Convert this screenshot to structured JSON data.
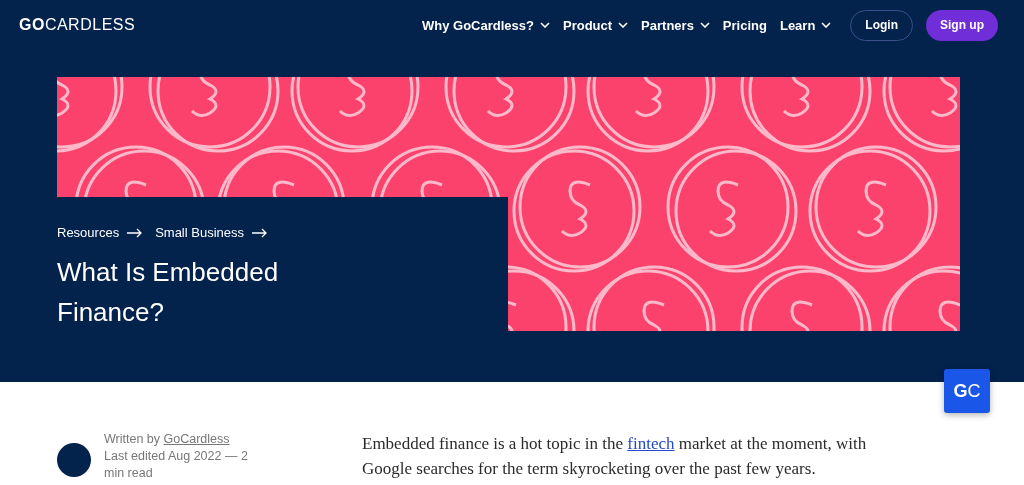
{
  "header": {
    "logo_bold": "GO",
    "logo_rest": "CARDLESS",
    "nav": [
      {
        "label": "Why GoCardless?",
        "dropdown": true
      },
      {
        "label": "Product",
        "dropdown": true
      },
      {
        "label": "Partners",
        "dropdown": true
      },
      {
        "label": "Pricing",
        "dropdown": false
      },
      {
        "label": "Learn",
        "dropdown": true
      }
    ],
    "login": "Login",
    "signup": "Sign up"
  },
  "hero": {
    "breadcrumbs": [
      "Resources",
      "Small Business"
    ],
    "title": "What Is Embedded Finance?"
  },
  "chat_badge": {
    "bold": "G",
    "rest": "C"
  },
  "article": {
    "author_prefix": "Written by",
    "author": "GoCardless",
    "edited": "Last edited Aug 2022 — 2",
    "read": "min read",
    "intro_before": "Embedded finance is a hot topic in the",
    "intro_link": "fintech",
    "intro_after": "market at the moment, with Google searches for the term skyrocketing over the past few years."
  }
}
